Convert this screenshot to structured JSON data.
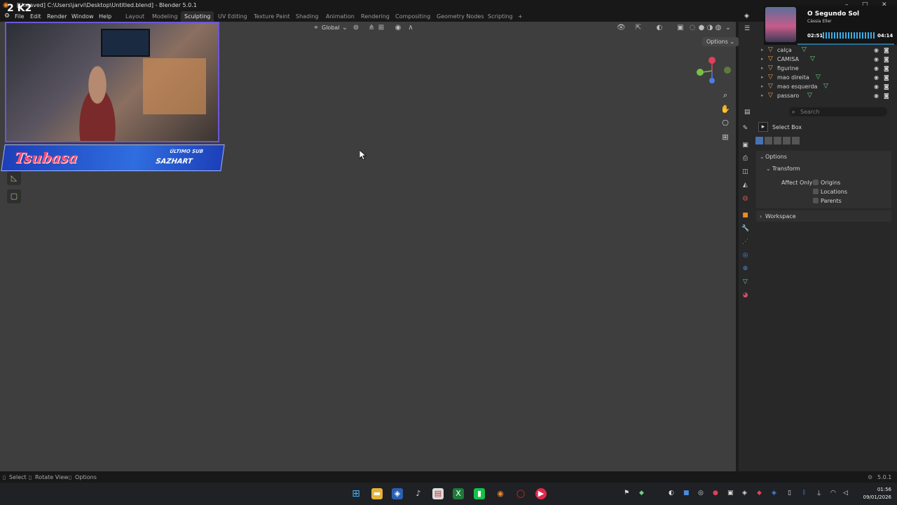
{
  "window": {
    "title": "[Unsaved] C:\\Users\\jarvi\\Desktop\\Untitled.blend] - Blender 5.0.1",
    "controls": [
      "–",
      "□",
      "✕"
    ]
  },
  "menus": [
    "File",
    "Edit",
    "Render",
    "Window",
    "Help"
  ],
  "workspace_tabs": [
    {
      "label": "Layout",
      "active": false
    },
    {
      "label": "Modeling",
      "active": false
    },
    {
      "label": "Sculpting",
      "active": true
    },
    {
      "label": "UV Editing",
      "active": false
    },
    {
      "label": "Texture Paint",
      "active": false
    },
    {
      "label": "Shading",
      "active": false
    },
    {
      "label": "Animation",
      "active": false
    },
    {
      "label": "Rendering",
      "active": false
    },
    {
      "label": "Compositing",
      "active": false
    },
    {
      "label": "Geometry Nodes",
      "active": false
    },
    {
      "label": "Scripting",
      "active": false
    }
  ],
  "add_tab": "+",
  "viewport": {
    "orientation": "Global",
    "options_label": "Options",
    "cursor_pos": "mouse cursor"
  },
  "stream_overlay": {
    "badge": "2 K2",
    "streamer_name": "Tsubasa",
    "last_sub_label": "ÚLTIMO SUB",
    "last_sub_name": "SAZHART"
  },
  "music": {
    "track": "O Segundo Sol",
    "artist": "Cássia Eller",
    "elapsed": "02:51",
    "total": "04:14"
  },
  "outliner": {
    "items": [
      {
        "label": "calça"
      },
      {
        "label": "CAMISA"
      },
      {
        "label": "figurine"
      },
      {
        "label": "mao direita"
      },
      {
        "label": "mao esquerda"
      },
      {
        "label": "passaro"
      }
    ]
  },
  "properties": {
    "search_placeholder": "Search",
    "active_tool": "Select Box",
    "options_panel": "Options",
    "transform_panel": "Transform",
    "affect_only_label": "Affect Only",
    "checkboxes": [
      "Origins",
      "Locations",
      "Parents"
    ],
    "workspace_panel": "Workspace"
  },
  "statusbar": {
    "select": "Select",
    "rotate": "Rotate View",
    "options": "Options",
    "version": "5.0.1"
  },
  "taskbar": {
    "time": "01:56",
    "date": "09/01/2026"
  },
  "colors": {
    "accent_tab": "#2d2d2d",
    "viewport_bg": "#3e3e3e",
    "overlay_blue": "#2f6ee0",
    "overlay_name": "#ff4d6d"
  }
}
